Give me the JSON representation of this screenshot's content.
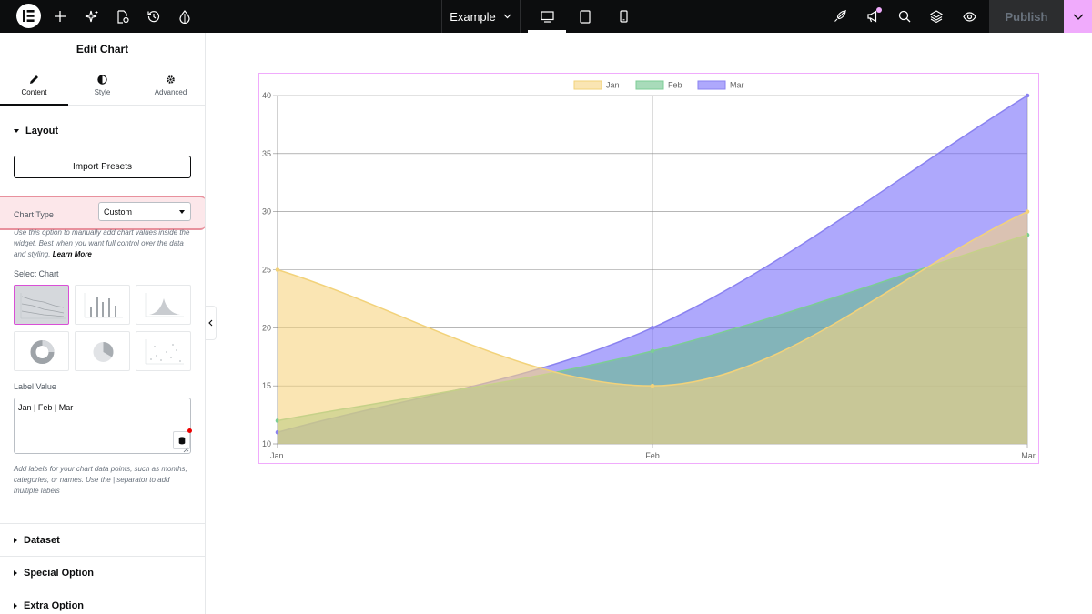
{
  "topbar": {
    "page_name": "Example",
    "publish_label": "Publish"
  },
  "panel": {
    "title": "Edit Chart",
    "tabs": [
      {
        "label": "Content",
        "icon": "pencil-icon"
      },
      {
        "label": "Style",
        "icon": "half-circle-icon"
      },
      {
        "label": "Advanced",
        "icon": "gear-icon"
      }
    ],
    "layout_section": "Layout",
    "import_presets_label": "Import Presets",
    "chart_type_label": "Chart Type",
    "chart_type_value": "Custom",
    "chart_type_help": "Use this option to manually add chart values inside the widget. Best when you want full control over the data and styling.",
    "learn_more": "Learn More",
    "select_chart_label": "Select Chart",
    "label_value_label": "Label Value",
    "label_value": "Jan | Feb | Mar",
    "label_help": "Add labels for your chart data points, such as months, categories, or names. Use the | separator to add multiple labels",
    "sections": [
      "Dataset",
      "Special Option",
      "Extra Option"
    ]
  },
  "chart_data": {
    "type": "area",
    "x": [
      "Jan",
      "Feb",
      "Mar"
    ],
    "ylim": [
      10,
      40
    ],
    "yticks": [
      10,
      15,
      20,
      25,
      30,
      35,
      40
    ],
    "legend_position": "top-center",
    "grid": true,
    "series": [
      {
        "name": "Jan",
        "values": [
          25,
          15,
          30
        ],
        "fill": "rgba(246,212,128,0.6)",
        "stroke": "#f2d27a"
      },
      {
        "name": "Feb",
        "values": [
          12,
          18,
          28
        ],
        "fill": "rgba(96,190,130,0.55)",
        "stroke": "#7ccd95"
      },
      {
        "name": "Mar",
        "values": [
          11,
          20,
          40
        ],
        "fill": "rgba(120,110,250,0.6)",
        "stroke": "#8a82f0"
      }
    ]
  }
}
